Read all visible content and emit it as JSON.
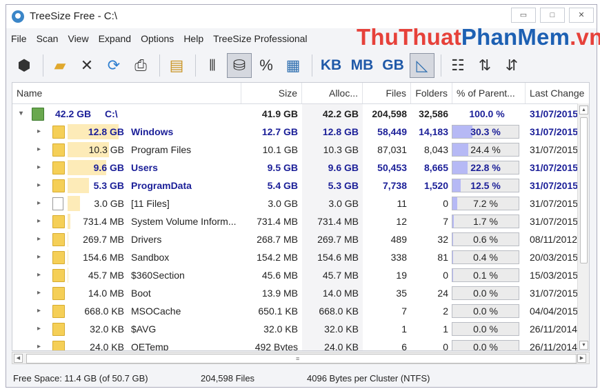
{
  "window": {
    "title": "TreeSize Free - C:\\",
    "buttons": [
      "▭",
      "□",
      "✕"
    ]
  },
  "menu": [
    "File",
    "Scan",
    "View",
    "Expand",
    "Options",
    "Help",
    "TreeSize Professional"
  ],
  "watermark": {
    "part1": "ThuThuat",
    "part2": "PhanMem",
    "part3": ".vn"
  },
  "toolbar": {
    "kb": "KB",
    "mb": "MB",
    "gb": "GB",
    "percent": "%"
  },
  "columns": {
    "name": "Name",
    "size": "Size",
    "alloc": "Alloc...",
    "files": "Files",
    "folders": "Folders",
    "percent": "% of Parent...",
    "last_change": "Last Change"
  },
  "root": {
    "size_label": "42.2 GB",
    "name": "C:\\",
    "size": "41.9 GB",
    "alloc": "42.2 GB",
    "files": "204,598",
    "folders": "32,586",
    "percent": "100.0 %",
    "last_change": "31/07/2015"
  },
  "rows": [
    {
      "size_label": "12.8 GB",
      "name": "Windows",
      "size": "12.7 GB",
      "alloc": "12.8 GB",
      "files": "58,449",
      "folders": "14,183",
      "percent": "30.3 %",
      "pct": 30.3,
      "last_change": "31/07/2015",
      "hl": true,
      "doc": false
    },
    {
      "size_label": "10.3 GB",
      "name": "Program Files",
      "size": "10.1 GB",
      "alloc": "10.3 GB",
      "files": "87,031",
      "folders": "8,043",
      "percent": "24.4 %",
      "pct": 24.4,
      "last_change": "31/07/2015",
      "hl": false,
      "doc": false
    },
    {
      "size_label": "9.6 GB",
      "name": "Users",
      "size": "9.5 GB",
      "alloc": "9.6 GB",
      "files": "50,453",
      "folders": "8,665",
      "percent": "22.8 %",
      "pct": 22.8,
      "last_change": "31/07/2015",
      "hl": true,
      "doc": false
    },
    {
      "size_label": "5.3 GB",
      "name": "ProgramData",
      "size": "5.4 GB",
      "alloc": "5.3 GB",
      "files": "7,738",
      "folders": "1,520",
      "percent": "12.5 %",
      "pct": 12.5,
      "last_change": "31/07/2015",
      "hl": true,
      "doc": false
    },
    {
      "size_label": "3.0 GB",
      "name": "[11 Files]",
      "size": "3.0 GB",
      "alloc": "3.0 GB",
      "files": "11",
      "folders": "0",
      "percent": "7.2 %",
      "pct": 7.2,
      "last_change": "31/07/2015",
      "hl": false,
      "doc": true
    },
    {
      "size_label": "731.4 MB",
      "name": "System Volume Inform...",
      "size": "731.4 MB",
      "alloc": "731.4 MB",
      "files": "12",
      "folders": "7",
      "percent": "1.7 %",
      "pct": 1.7,
      "last_change": "31/07/2015",
      "hl": false,
      "doc": false
    },
    {
      "size_label": "269.7 MB",
      "name": "Drivers",
      "size": "268.7 MB",
      "alloc": "269.7 MB",
      "files": "489",
      "folders": "32",
      "percent": "0.6 %",
      "pct": 0.6,
      "last_change": "08/11/2012",
      "hl": false,
      "doc": false
    },
    {
      "size_label": "154.6 MB",
      "name": "Sandbox",
      "size": "154.2 MB",
      "alloc": "154.6 MB",
      "files": "338",
      "folders": "81",
      "percent": "0.4 %",
      "pct": 0.4,
      "last_change": "20/03/2015",
      "hl": false,
      "doc": false
    },
    {
      "size_label": "45.7 MB",
      "name": "$360Section",
      "size": "45.6 MB",
      "alloc": "45.7 MB",
      "files": "19",
      "folders": "0",
      "percent": "0.1 %",
      "pct": 0.1,
      "last_change": "15/03/2015",
      "hl": false,
      "doc": false
    },
    {
      "size_label": "14.0 MB",
      "name": "Boot",
      "size": "13.9 MB",
      "alloc": "14.0 MB",
      "files": "35",
      "folders": "24",
      "percent": "0.0 %",
      "pct": 0.0,
      "last_change": "31/07/2015",
      "hl": false,
      "doc": false
    },
    {
      "size_label": "668.0 KB",
      "name": "MSOCache",
      "size": "650.1 KB",
      "alloc": "668.0 KB",
      "files": "7",
      "folders": "2",
      "percent": "0.0 %",
      "pct": 0.0,
      "last_change": "04/04/2015",
      "hl": false,
      "doc": false
    },
    {
      "size_label": "32.0 KB",
      "name": "$AVG",
      "size": "32.0 KB",
      "alloc": "32.0 KB",
      "files": "1",
      "folders": "1",
      "percent": "0.0 %",
      "pct": 0.0,
      "last_change": "26/11/2014",
      "hl": false,
      "doc": false
    },
    {
      "size_label": "24.0 KB",
      "name": "OETemp",
      "size": "492 Bytes",
      "alloc": "24.0 KB",
      "files": "6",
      "folders": "0",
      "percent": "0.0 %",
      "pct": 0.0,
      "last_change": "26/11/2014",
      "hl": false,
      "doc": false
    }
  ],
  "status": {
    "free": "Free Space: 11.4 GB  (of 50.7 GB)",
    "files": "204,598  Files",
    "cluster": "4096 Bytes per Cluster (NTFS)"
  }
}
